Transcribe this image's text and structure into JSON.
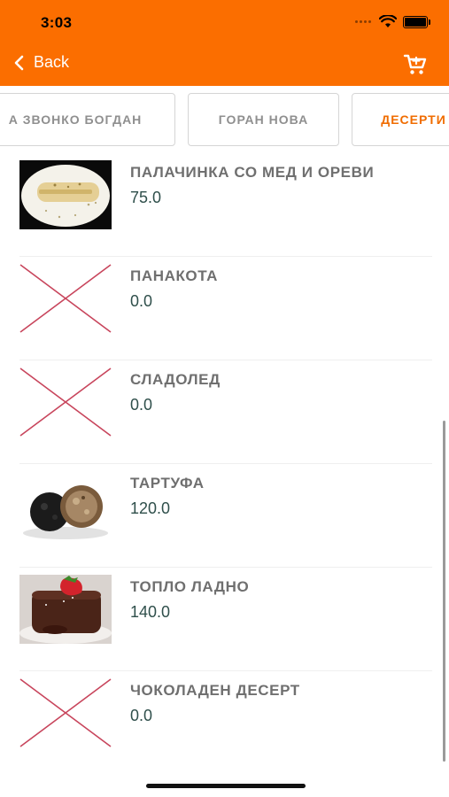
{
  "status_bar": {
    "time": "3:03"
  },
  "nav": {
    "back_label": "Back"
  },
  "colors": {
    "accent": "#fb6e00",
    "active_tab": "#f06c00",
    "price": "#2f4f4b",
    "placeholder_x": "#c8455c"
  },
  "icons": {
    "back": "chevron-left-icon",
    "cart": "cart-icon",
    "wifi": "wifi-icon",
    "battery": "battery-icon"
  },
  "tabs": [
    {
      "label": "А ЗВОНКО БОГДАН",
      "active": false
    },
    {
      "label": "ГОРАН НОВА",
      "active": false
    },
    {
      "label": "ДЕСЕРТИ",
      "active": true
    }
  ],
  "items": [
    {
      "name": "ПАЛАЧИНКА СО МЕД И ОРЕВИ",
      "price": "75.0",
      "image": "pancake"
    },
    {
      "name": "ПАНАКОТА",
      "price": "0.0",
      "image": "none"
    },
    {
      "name": "СЛАДОЛЕД",
      "price": "0.0",
      "image": "none"
    },
    {
      "name": "ТАРТУФА",
      "price": "120.0",
      "image": "truffles"
    },
    {
      "name": "ТОПЛО ЛАДНО",
      "price": "140.0",
      "image": "lava-cake"
    },
    {
      "name": "ЧОКОЛАДЕН ДЕСЕРТ",
      "price": "0.0",
      "image": "none"
    }
  ]
}
